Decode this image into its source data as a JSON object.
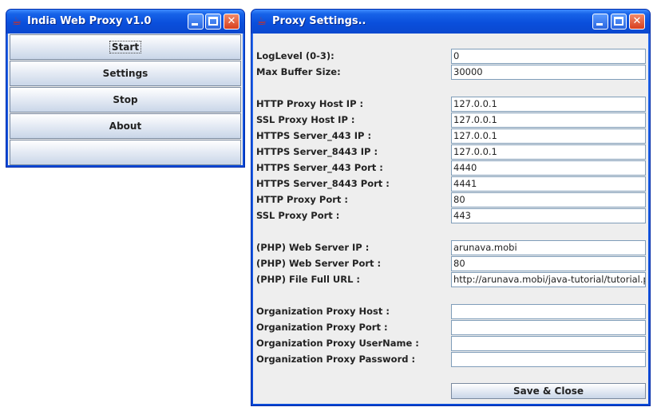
{
  "main_window": {
    "title": "India Web Proxy v1.0",
    "buttons": [
      {
        "label": "Start"
      },
      {
        "label": "Settings"
      },
      {
        "label": "Stop"
      },
      {
        "label": "About"
      },
      {
        "label": ""
      }
    ]
  },
  "settings_window": {
    "title": "Proxy Settings..",
    "fields": [
      {
        "label": "LogLevel (0-3):",
        "value": "0"
      },
      {
        "label": "Max Buffer Size:",
        "value": "30000"
      },
      {
        "label": "HTTP Proxy Host IP :",
        "value": "127.0.0.1"
      },
      {
        "label": "SSL Proxy Host IP :",
        "value": "127.0.0.1"
      },
      {
        "label": "HTTPS Server_443 IP :",
        "value": "127.0.0.1"
      },
      {
        "label": "HTTPS Server_8443 IP :",
        "value": "127.0.0.1"
      },
      {
        "label": "HTTPS Server_443 Port :",
        "value": "4440"
      },
      {
        "label": "HTTPS Server_8443 Port :",
        "value": "4441"
      },
      {
        "label": "HTTP Proxy Port :",
        "value": "80"
      },
      {
        "label": "SSL Proxy Port :",
        "value": "443"
      },
      {
        "label": "(PHP) Web Server IP :",
        "value": "arunava.mobi"
      },
      {
        "label": "(PHP) Web Server Port :",
        "value": "80"
      },
      {
        "label": "(PHP) File Full URL :",
        "value": "http://arunava.mobi/java-tutorial/tutorial.php"
      },
      {
        "label": "Organization Proxy Host :",
        "value": ""
      },
      {
        "label": "Organization Proxy Port :",
        "value": ""
      },
      {
        "label": "Organization Proxy UserName :",
        "value": ""
      },
      {
        "label": "Organization Proxy Password :",
        "value": ""
      }
    ],
    "save_label": "Save & Close"
  },
  "colors": {
    "titlebar": "#0a4fdc",
    "client": "#eeeeee",
    "field_border": "#7f9db9"
  },
  "icons": {
    "window_icon": "java-cup-icon",
    "minimize": "minimize-icon",
    "maximize": "maximize-icon",
    "close": "close-icon"
  }
}
